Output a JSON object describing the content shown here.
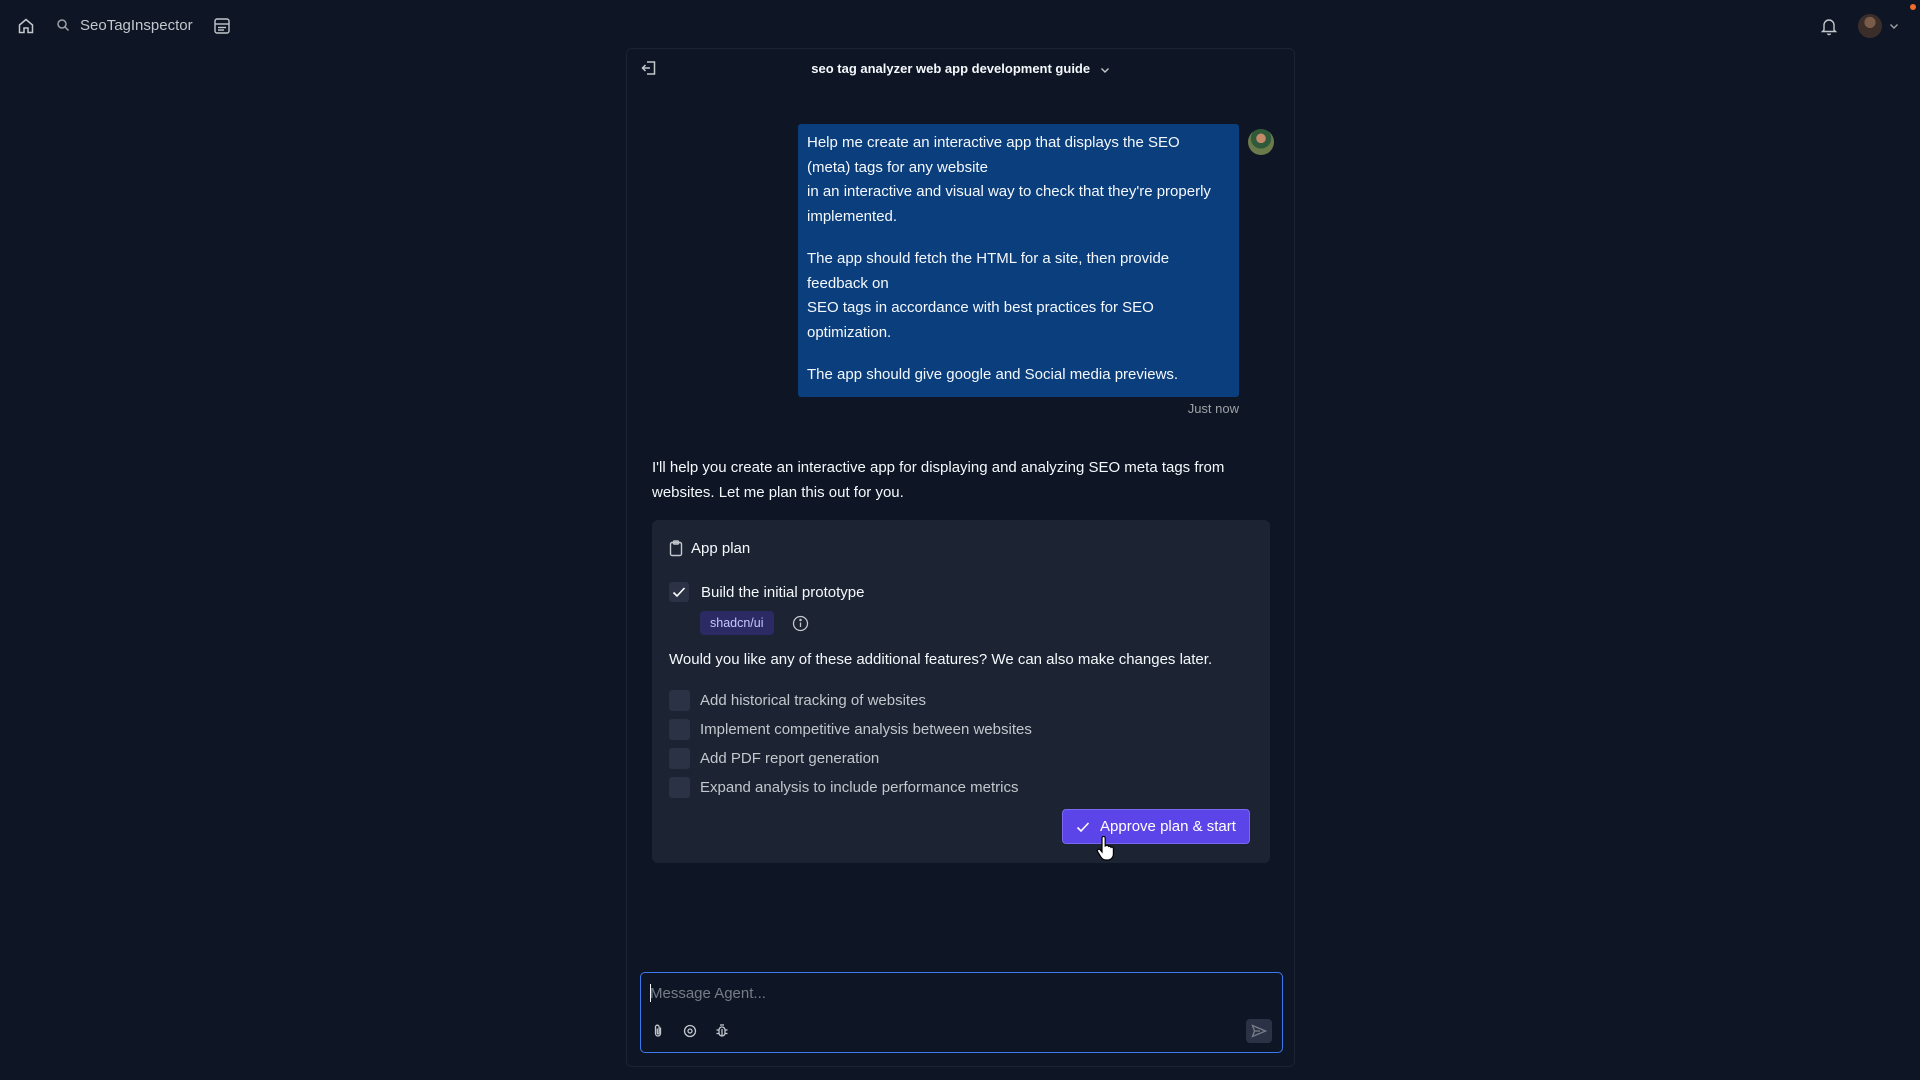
{
  "topbar": {
    "project_name": "SeoTagInspector",
    "icons": [
      "home-icon",
      "search-icon",
      "layout-icon",
      "bell-icon",
      "avatar",
      "chevron-down-icon"
    ]
  },
  "chat": {
    "title": "seo tag analyzer web app development guide",
    "user_message": {
      "paragraphs": [
        [
          "Help me create an interactive app that displays the SEO",
          "(meta) tags for any website",
          "in an interactive and visual way to check that they're properly",
          "implemented."
        ],
        [
          "The app should fetch the HTML for a site, then provide",
          "feedback on",
          "SEO tags in accordance with best practices for SEO",
          "optimization."
        ],
        [
          "The app should give google and Social media previews."
        ]
      ],
      "timestamp": "Just now"
    },
    "agent_message": {
      "lines": [
        "I'll help you create an interactive app for displaying and analyzing SEO meta tags from",
        "websites. Let me plan this out for you."
      ]
    },
    "plan": {
      "title": "App plan",
      "prototype_label": "Build the initial prototype",
      "prototype_checked": true,
      "badge": "shadcn/ui",
      "features_question": "Would you like any of these additional features? We can also make changes later.",
      "features": [
        {
          "label": "Add historical tracking of websites",
          "checked": false
        },
        {
          "label": "Implement competitive analysis between websites",
          "checked": false
        },
        {
          "label": "Add PDF report generation",
          "checked": false
        },
        {
          "label": "Expand analysis to include performance metrics",
          "checked": false
        }
      ],
      "approve_label": "Approve plan & start"
    }
  },
  "composer": {
    "placeholder": "Message Agent...",
    "value": ""
  },
  "colors": {
    "background": "#0e1525",
    "user_bubble": "#0b3e7d",
    "card": "#1c2333",
    "accent": "#5b45e8",
    "badge_bg": "#2b2a63",
    "composer_border": "#3d78f0"
  }
}
